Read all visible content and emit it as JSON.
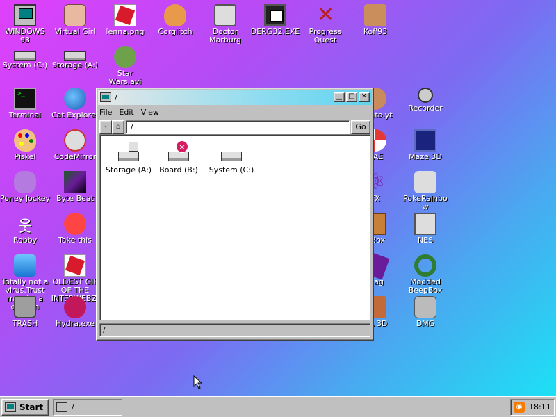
{
  "desktop": {
    "icons": [
      {
        "label": "WINDOWS 93",
        "icon": "computer-icon"
      },
      {
        "label": "Virtual Girl",
        "icon": "face-icon"
      },
      {
        "label": "lenna.png",
        "icon": "image-icon"
      },
      {
        "label": "Corglitch",
        "icon": "dog-icon"
      },
      {
        "label": "Doctor Marburg",
        "icon": "doctor-icon"
      },
      {
        "label": "DERG32.EXE",
        "icon": "monitor-icon"
      },
      {
        "label": "Progress Quest",
        "icon": "swords-icon"
      },
      {
        "label": "Kof'93",
        "icon": "fighter-icon"
      },
      {
        "label": "System (C:)",
        "icon": "drive-icon"
      },
      {
        "label": "Storage (A:)",
        "icon": "floppy-drive-icon"
      },
      {
        "label": "Star Wars.avi",
        "icon": "yoda-icon"
      },
      {
        "label": "Terminal",
        "icon": "terminal-icon"
      },
      {
        "label": "Cat Explorer",
        "icon": "globe-icon"
      },
      {
        "label": "Piskel",
        "icon": "palette-icon"
      },
      {
        "label": "CodeMirror",
        "icon": "cat-icon"
      },
      {
        "label": "Poney Jockey",
        "icon": "pony-icon"
      },
      {
        "label": "Byte Beat",
        "icon": "glitch-icon"
      },
      {
        "label": "Robby",
        "icon": "stickman-icon"
      },
      {
        "label": "Take this",
        "icon": "clown-icon"
      },
      {
        "label": "Totally not a virus.Trust me...im a dolphin",
        "icon": "dolphin-icon"
      },
      {
        "label": "OLDEST GIF OF THE INTERWEBZ.gif",
        "icon": "gif-icon"
      },
      {
        "label": "TRASH",
        "icon": "trash-icon"
      },
      {
        "label": "Hydra.exe",
        "icon": "hydra-icon"
      },
      {
        "label": "Potato.yt",
        "icon": "potato-icon"
      },
      {
        "label": "Recorder",
        "icon": "microphone-icon"
      },
      {
        "label": "UAE",
        "icon": "ball-icon"
      },
      {
        "label": "Maze 3D",
        "icon": "maze-icon"
      },
      {
        "label": "FX",
        "icon": "atom-icon"
      },
      {
        "label": "PokeRainbow",
        "icon": "pokemon-icon"
      },
      {
        "label": "BBox",
        "icon": "box-icon"
      },
      {
        "label": "NES",
        "icon": "nes-icon"
      },
      {
        "label": "Frag",
        "icon": "frag-icon"
      },
      {
        "label": "Modded BeepBox",
        "icon": "ring-icon"
      },
      {
        "label": "DA 3D",
        "icon": "doom-icon"
      },
      {
        "label": "DMG",
        "icon": "gameboy-icon"
      }
    ]
  },
  "window": {
    "title": "/",
    "menu": [
      "File",
      "Edit",
      "View"
    ],
    "address": "/",
    "go_label": "Go",
    "items": [
      {
        "label": "Storage (A:)"
      },
      {
        "label": "Board (B:)"
      },
      {
        "label": "System (C:)"
      }
    ],
    "status": "/"
  },
  "taskbar": {
    "start_label": "Start",
    "task_label": "/",
    "clock": "18:11"
  }
}
